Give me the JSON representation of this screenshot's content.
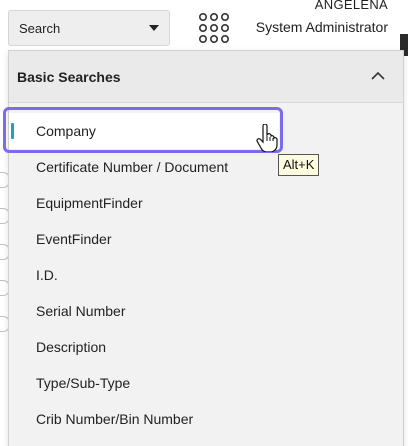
{
  "header": {
    "search_select_value": "Search",
    "user_name": "ANGELENA",
    "user_role": "System Administrator"
  },
  "panel": {
    "title": "Basic Searches",
    "items": [
      {
        "label": "Company"
      },
      {
        "label": "Certificate Number / Document"
      },
      {
        "label": "EquipmentFinder"
      },
      {
        "label": "EventFinder"
      },
      {
        "label": "I.D."
      },
      {
        "label": "Serial Number"
      },
      {
        "label": "Description"
      },
      {
        "label": "Type/Sub-Type"
      },
      {
        "label": "Crib Number/Bin Number"
      }
    ],
    "active_index": 0
  },
  "tooltip": {
    "text": "Alt+K"
  },
  "colors": {
    "focus_ring": "#7b6bf0",
    "active_indicator": "#1aa3c7",
    "panel_bg": "#f2f2f2"
  },
  "icons": {
    "apps": "apps-grid-icon",
    "caret": "caret-down-icon",
    "collapse": "chevron-up-icon",
    "cursor": "hand-cursor-icon"
  }
}
